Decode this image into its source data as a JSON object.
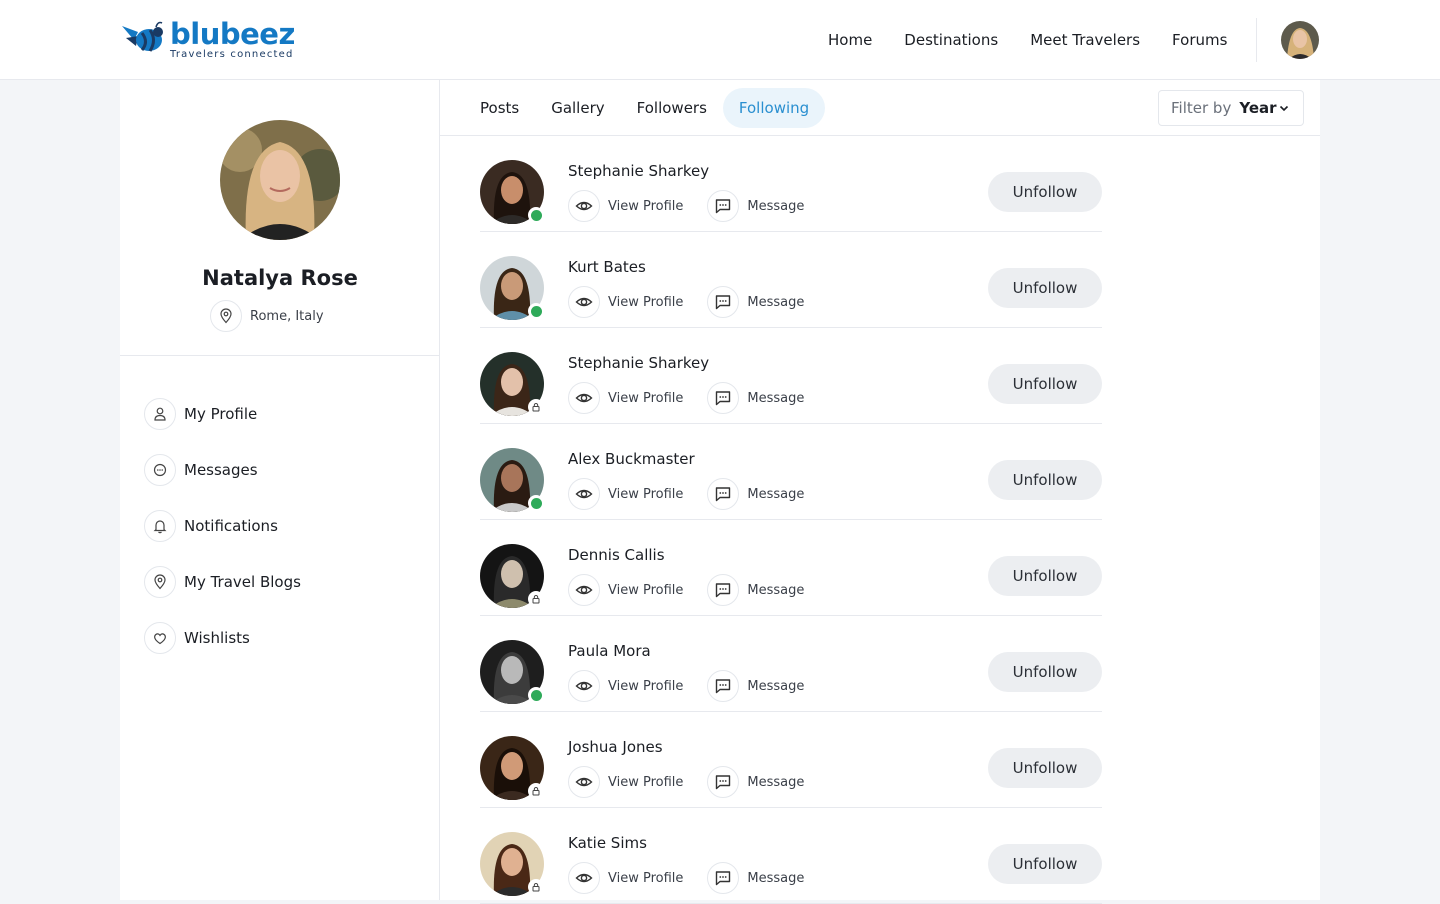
{
  "brand": {
    "name": "blubeez",
    "tagline": "Travelers connected",
    "color": "#1479c4"
  },
  "nav": [
    "Home",
    "Destinations",
    "Meet Travelers",
    "Forums"
  ],
  "profile": {
    "name": "Natalya Rose",
    "location": "Rome, Italy"
  },
  "menu": [
    {
      "label": "My Profile",
      "icon": "user-icon"
    },
    {
      "label": "Messages",
      "icon": "chat-icon"
    },
    {
      "label": "Notifications",
      "icon": "bell-icon"
    },
    {
      "label": "My Travel Blogs",
      "icon": "map-pin-icon"
    },
    {
      "label": "Wishlists",
      "icon": "heart-icon"
    }
  ],
  "tabs": [
    "Posts",
    "Gallery",
    "Followers",
    "Following"
  ],
  "active_tab": "Following",
  "filter": {
    "label": "Filter by",
    "value": "Year"
  },
  "labels": {
    "view_profile": "View Profile",
    "message": "Message",
    "unfollow": "Unfollow"
  },
  "following": [
    {
      "name": "Stephanie Sharkey",
      "status": "public"
    },
    {
      "name": "Kurt Bates",
      "status": "public"
    },
    {
      "name": "Stephanie Sharkey",
      "status": "private"
    },
    {
      "name": "Alex Buckmaster",
      "status": "public"
    },
    {
      "name": "Dennis Callis",
      "status": "private"
    },
    {
      "name": "Paula Mora",
      "status": "public"
    },
    {
      "name": "Joshua Jones",
      "status": "private"
    },
    {
      "name": "Katie Sims",
      "status": "private"
    }
  ],
  "colors": {
    "accent": "#2a8fd0",
    "online": "#2eaa59",
    "tab_active_bg": "#eaf4fb"
  }
}
